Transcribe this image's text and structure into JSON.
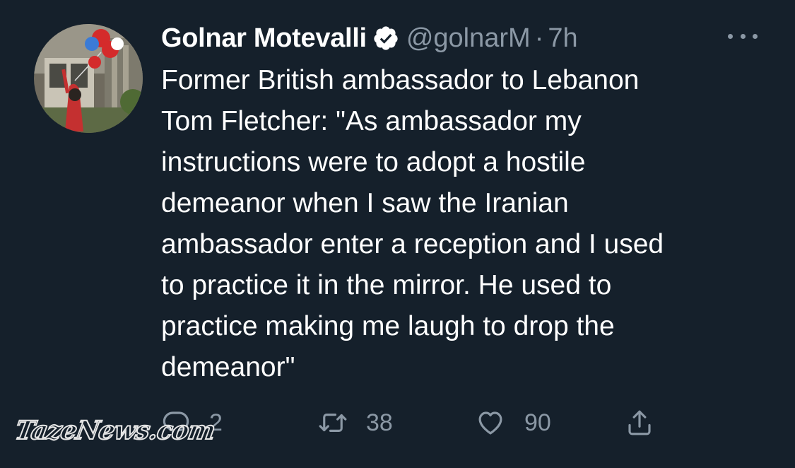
{
  "author": {
    "display_name": "Golnar Motevalli",
    "handle": "@golnarM",
    "separator": "·",
    "time": "7h",
    "verified_icon": "verified-badge-icon",
    "avatar_description_icon": "avatar-photo"
  },
  "tweet": {
    "text": "Former British ambassador to Lebanon\nTom Fletcher: \"As ambassador my\ninstructions were to adopt a hostile\ndemeanor when I saw the Iranian\nambassador enter a reception and I used\nto practice it in the mirror. He used to\npractice making me laugh to drop the\ndemeanor\""
  },
  "actions": {
    "reply": {
      "icon": "reply-icon",
      "count": "2"
    },
    "retweet": {
      "icon": "retweet-icon",
      "count": "38"
    },
    "like": {
      "icon": "heart-icon",
      "count": "90"
    },
    "share": {
      "icon": "share-icon"
    }
  },
  "more_icon": "more-options-icon",
  "watermark": "TazeNews.com",
  "colors": {
    "background": "#15202b",
    "primary_text": "#ffffff",
    "secondary_text": "#8b98a5"
  }
}
